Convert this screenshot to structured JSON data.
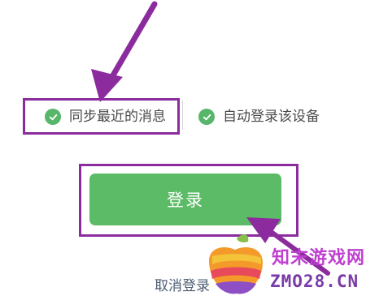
{
  "options": {
    "sync_recent_messages": {
      "label": "同步最近的消息",
      "checked": true
    },
    "auto_login_device": {
      "label": "自动登录该设备",
      "checked": true
    }
  },
  "login_button": {
    "label": "登录"
  },
  "cancel_login": {
    "label": "取消登录"
  },
  "watermark": {
    "name": "知末游戏网",
    "url": "ZMO28.CN"
  },
  "colors": {
    "accent_green": "#5cbb66",
    "annotation_purple": "#8b2b9e"
  },
  "icons": {
    "check": "check-circle-icon",
    "annotation_arrow": "arrow-annotation"
  }
}
